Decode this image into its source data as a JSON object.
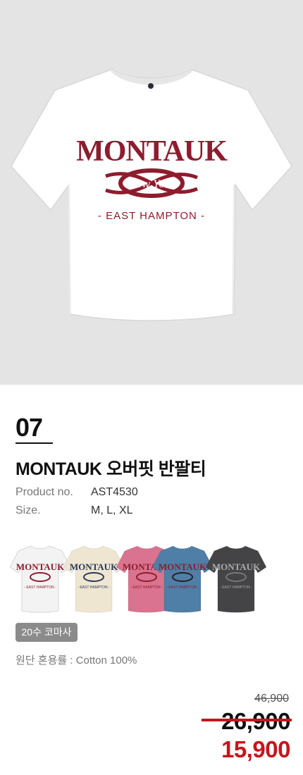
{
  "product": {
    "number": "07",
    "name": "MONTAUK 오버핏 반팔티",
    "graphic": {
      "headline": "MONTAUK",
      "script": "New York",
      "tagline": "- EAST HAMPTON -"
    }
  },
  "specs": [
    {
      "label": "Product no.",
      "value": "AST4530"
    },
    {
      "label": "Size.",
      "value": "M, L, XL"
    }
  ],
  "colors": {
    "print": "#8e1c2e",
    "swatches": [
      "#f3f3f3",
      "#efe6d2",
      "#d9738f",
      "#4f7ea6",
      "#444446"
    ]
  },
  "fabric": {
    "badge": "20수 코마사",
    "blend": "원단 혼용률 : Cotton 100%"
  },
  "price": {
    "original": "46,900",
    "previous": "26,900",
    "sale": "15,900"
  }
}
